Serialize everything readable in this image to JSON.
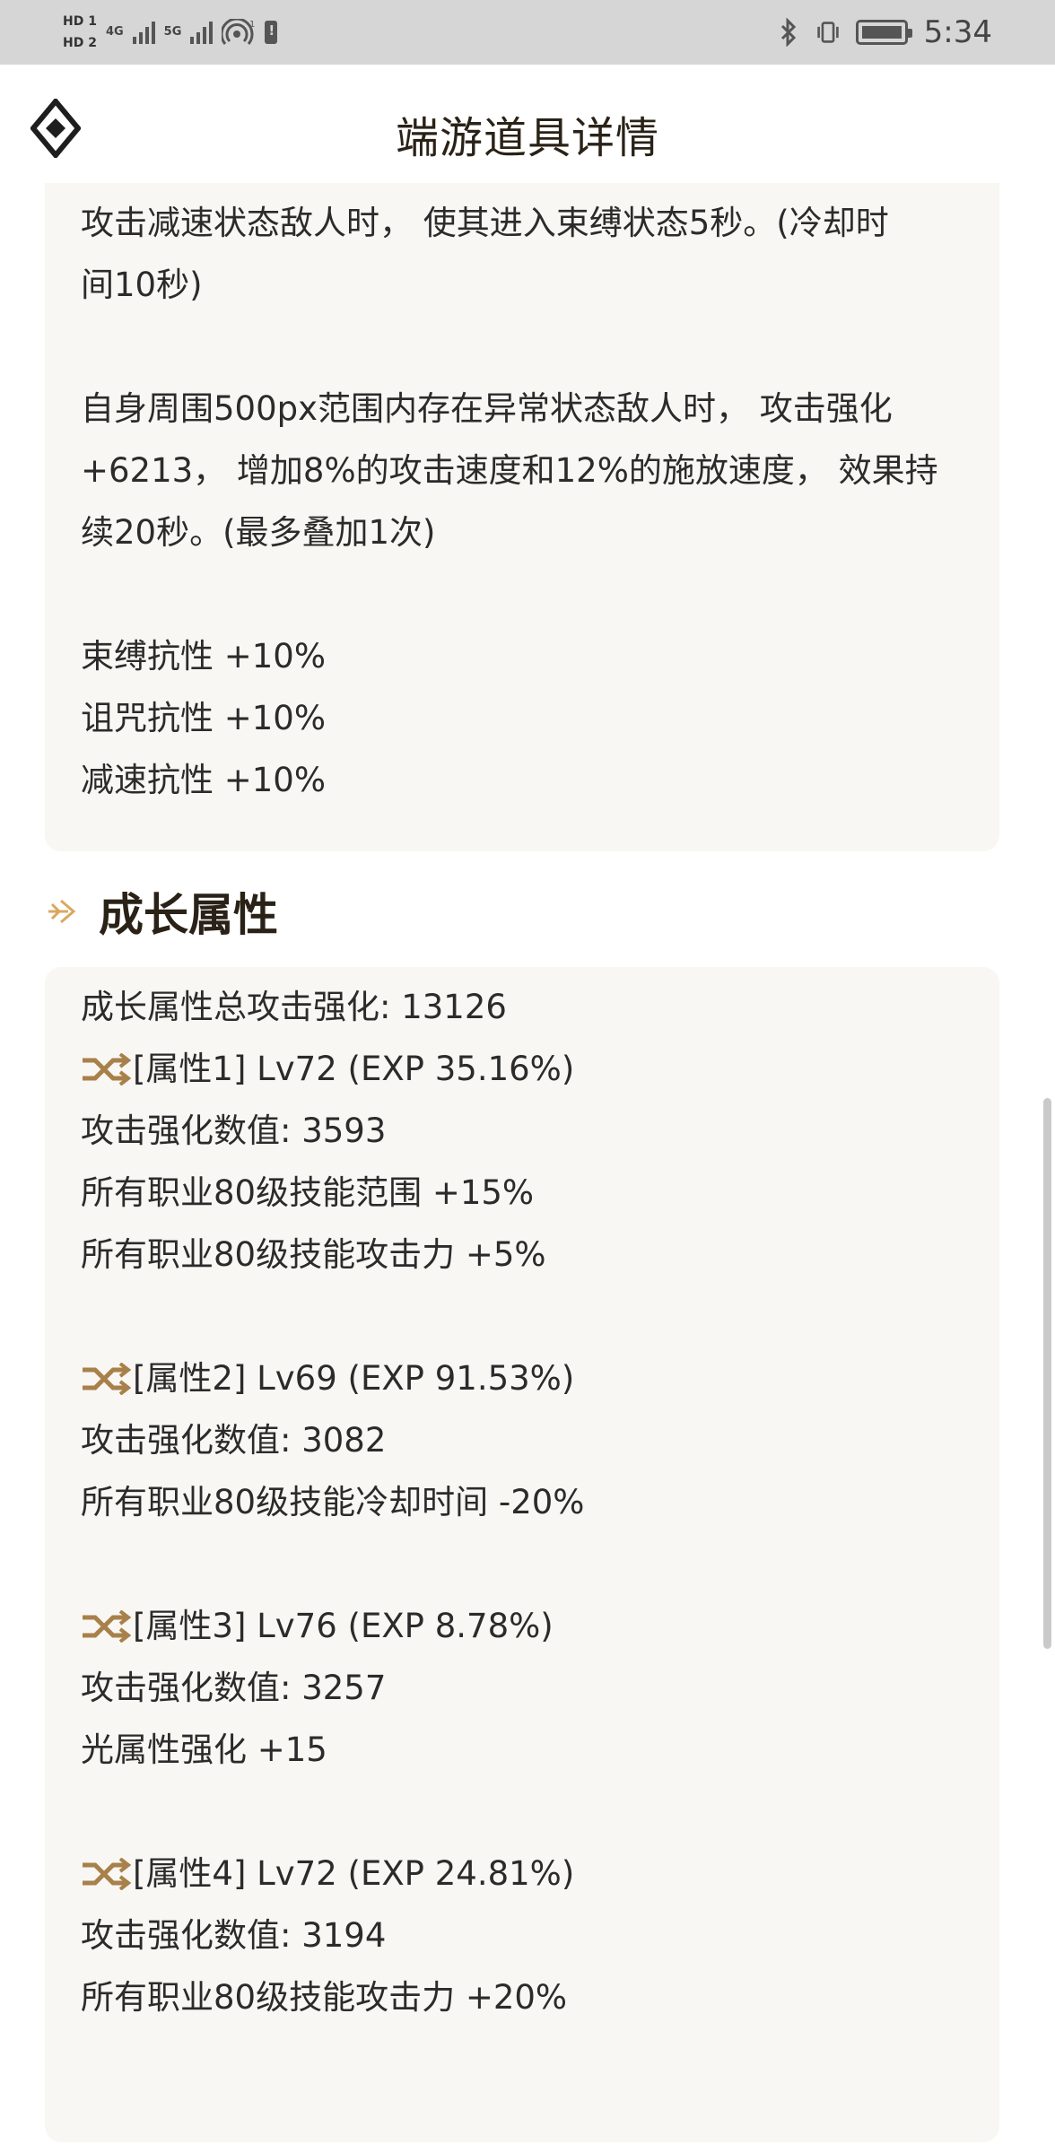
{
  "status_bar": {
    "hd1": "HD 1",
    "hd2": "HD 2",
    "net1": "4G",
    "net2": "5G",
    "wifi_sup": "1",
    "time": "5:34"
  },
  "header": {
    "title": "端游道具详情"
  },
  "effect_card": {
    "lines": [
      "攻击减速状态敌人时， 使其进入束缚状态5秒。(冷却时",
      "间10秒)",
      "自身周围500px范围内存在异常状态敌人时， 攻击强化",
      "+6213， 增加8%的攻击速度和12%的施放速度， 效果持",
      "续20秒。(最多叠加1次)",
      "束缚抗性 +10%",
      "诅咒抗性 +10%",
      "减速抗性 +10%"
    ]
  },
  "growth": {
    "title": "成长属性",
    "total": "成长属性总攻击强化: 13126",
    "attributes": [
      {
        "header": "[属性1] Lv72 (EXP 35.16%)",
        "lines": [
          "攻击强化数值:  3593",
          "所有职业80级技能范围 +15%",
          "所有职业80级技能攻击力 +5%"
        ]
      },
      {
        "header": "[属性2] Lv69 (EXP 91.53%)",
        "lines": [
          "攻击强化数值:  3082",
          "所有职业80级技能冷却时间 -20%"
        ]
      },
      {
        "header": "[属性3] Lv76 (EXP 8.78%)",
        "lines": [
          "攻击强化数值:  3257",
          "光属性强化 +15"
        ]
      },
      {
        "header": "[属性4] Lv72 (EXP 24.81%)",
        "lines": [
          "攻击强化数值:  3194",
          "所有职业80级技能攻击力 +20%"
        ]
      }
    ]
  },
  "colors": {
    "accent_gold": "#d9a860",
    "card_bg": "#f9f7f3",
    "title_text": "#2a2217"
  }
}
